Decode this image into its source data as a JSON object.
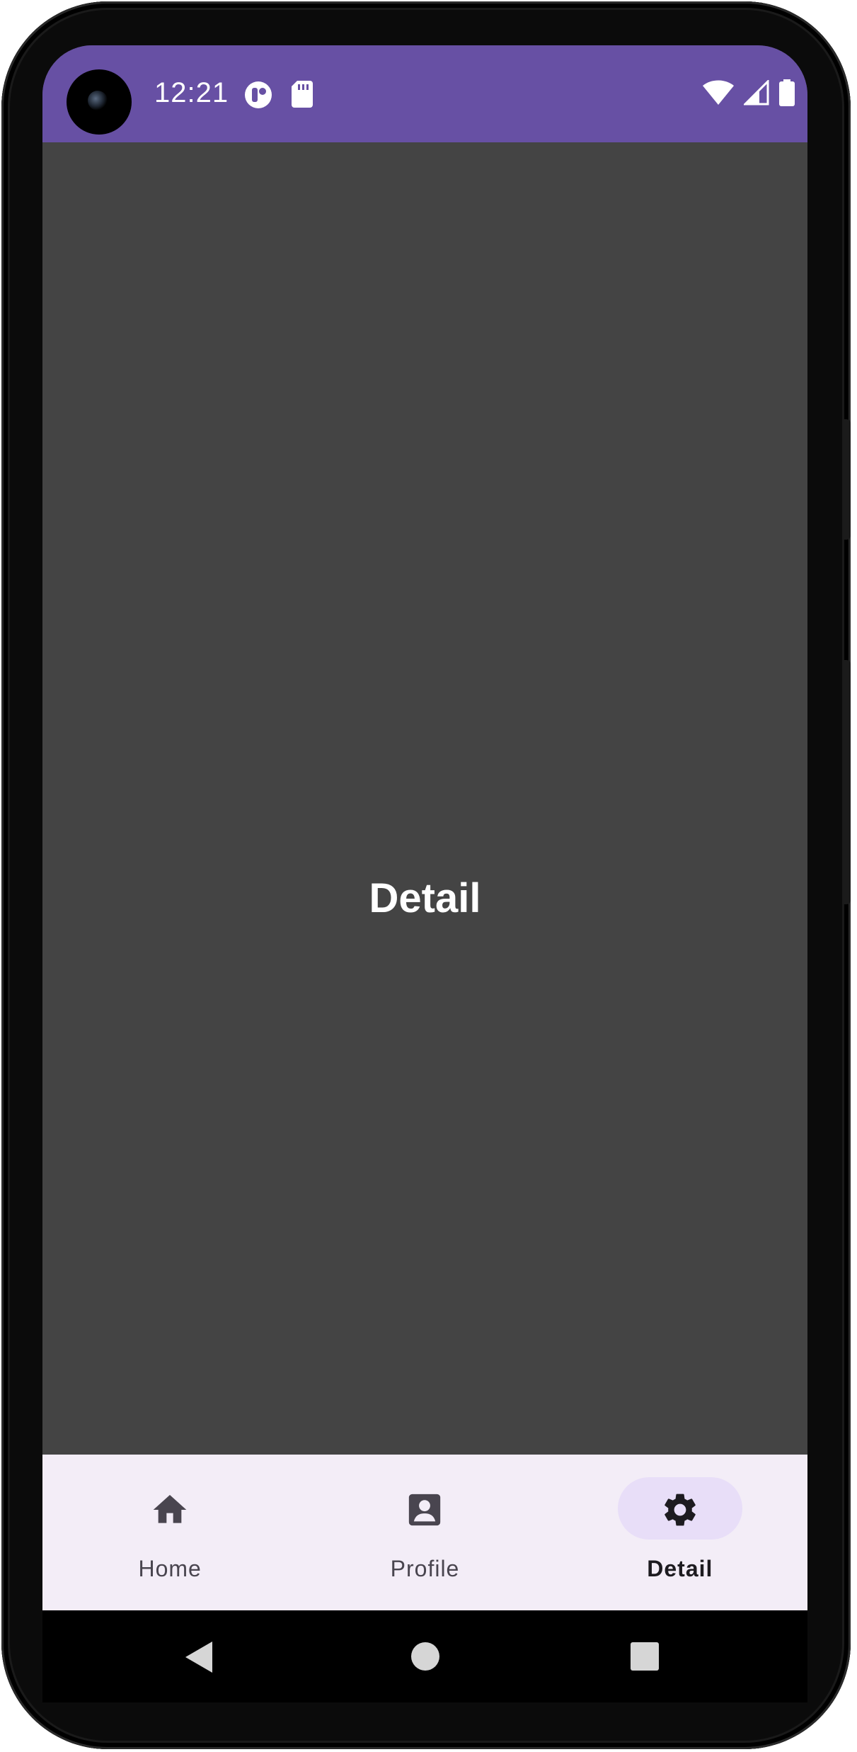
{
  "status_bar": {
    "time": "12:21",
    "background": "#6750a4",
    "icons": [
      "app-notification-icon",
      "sd-card-icon",
      "wifi-icon",
      "cell-signal-icon",
      "battery-icon"
    ]
  },
  "content": {
    "title": "Detail",
    "background": "#444444"
  },
  "bottom_nav": {
    "background": "#f3edf7",
    "active_indicator": "#e8def8",
    "items": [
      {
        "label": "Home",
        "icon": "home-icon",
        "active": false
      },
      {
        "label": "Profile",
        "icon": "profile-icon",
        "active": false
      },
      {
        "label": "Detail",
        "icon": "gear-icon",
        "active": true
      }
    ]
  },
  "system_nav": {
    "buttons": [
      "back-icon",
      "home-circle-icon",
      "recents-square-icon"
    ]
  }
}
